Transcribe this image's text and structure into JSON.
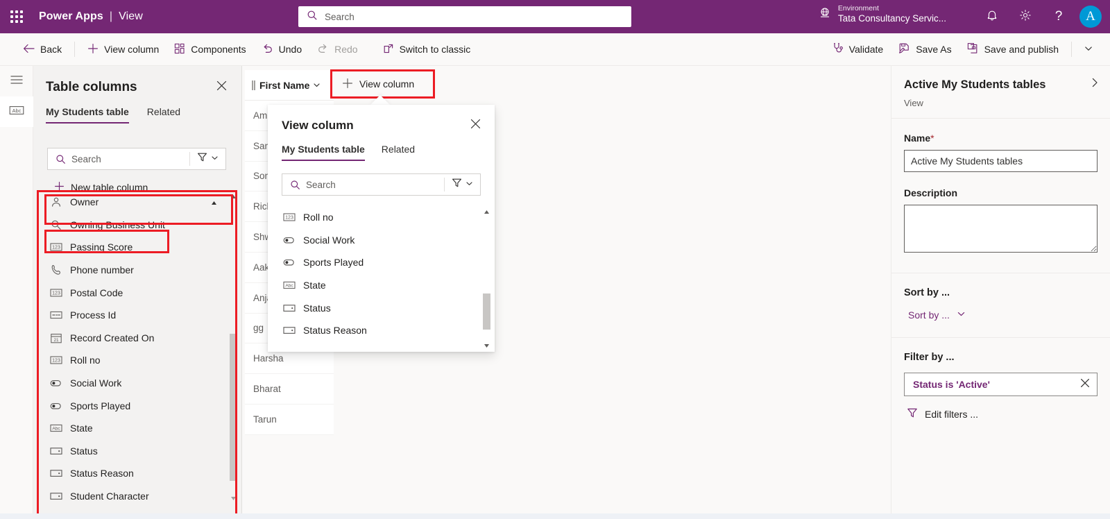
{
  "header": {
    "waffle_icon": "waffle-grid-icon",
    "brand": "Power Apps",
    "separator": "|",
    "brand_sub": "View",
    "search_placeholder": "Search",
    "search_icon": "search-icon",
    "environment_label": "Environment",
    "environment_name": "Tata Consultancy Servic...",
    "environment_icon": "globe-icon",
    "notifications_icon": "bell-icon",
    "settings_icon": "gear-icon",
    "help_icon": "question-icon",
    "avatar_initial": "A",
    "avatar_color": "#0099d6",
    "brand_color": "#742774"
  },
  "commandbar": {
    "items": [
      {
        "label": "Back",
        "icon": "arrow-left-icon",
        "disabled": false
      },
      {
        "label": "View column",
        "icon": "plus-icon",
        "disabled": false
      },
      {
        "label": "Components",
        "icon": "components-icon",
        "disabled": false
      },
      {
        "label": "Undo",
        "icon": "undo-icon",
        "disabled": false
      },
      {
        "label": "Redo",
        "icon": "redo-icon",
        "disabled": true
      },
      {
        "label": "Switch to classic",
        "icon": "open-external-icon",
        "disabled": false
      }
    ],
    "right_items": [
      {
        "label": "Validate",
        "icon": "stethoscope-icon"
      },
      {
        "label": "Save As",
        "icon": "save-as-icon"
      },
      {
        "label": "Save and publish",
        "icon": "save-publish-icon"
      }
    ],
    "overflow_icon": "chevron-down-icon"
  },
  "rail": {
    "items": [
      {
        "icon": "hamburger-icon",
        "active": false
      },
      {
        "icon": "abc-text-icon",
        "active": true
      }
    ]
  },
  "left_panel": {
    "title": "Table columns",
    "close_icon": "close-icon",
    "tabs": [
      {
        "label": "My Students table",
        "active": true
      },
      {
        "label": "Related",
        "active": false
      }
    ],
    "search_placeholder": "Search",
    "search_icon": "search-icon",
    "filter_icon": "funnel-icon",
    "filter_chevron_icon": "chevron-down-icon",
    "new_column_label": "New table column",
    "new_column_icon": "plus-icon",
    "scroll_up_icon": "caret-up-icon",
    "scroll_down_icon": "caret-down-icon",
    "columns": [
      {
        "label": "Owner",
        "icon": "person-icon",
        "trailing_icon": "caret-up-icon"
      },
      {
        "label": "Owning Business Unit",
        "icon": "lookup-icon"
      },
      {
        "label": "Passing Score",
        "icon": "number-123-icon"
      },
      {
        "label": "Phone number",
        "icon": "phone-icon"
      },
      {
        "label": "Postal Code",
        "icon": "number-123-icon"
      },
      {
        "label": "Process Id",
        "icon": "unique-id-icon"
      },
      {
        "label": "Record Created On",
        "icon": "calendar-21-icon"
      },
      {
        "label": "Roll no",
        "icon": "number-123-icon"
      },
      {
        "label": "Social Work",
        "icon": "toggle-icon"
      },
      {
        "label": "Sports Played",
        "icon": "toggle-icon"
      },
      {
        "label": "State",
        "icon": "abc-text-icon"
      },
      {
        "label": "Status",
        "icon": "choice-icon"
      },
      {
        "label": "Status Reason",
        "icon": "choice-icon"
      },
      {
        "label": "Student Character",
        "icon": "choice-icon"
      }
    ]
  },
  "grid": {
    "column_header": "First Name",
    "header_sort_icon": "chevron-down-icon",
    "add_column_label": "View column",
    "add_column_icon": "plus-icon",
    "rows": [
      "Ami",
      "Sanj",
      "Soni",
      "Rich",
      "Shw",
      "Aaka",
      "Anja",
      "gg",
      "Harsha",
      "Bharat",
      "Tarun"
    ]
  },
  "callout": {
    "title": "View column",
    "close_icon": "close-icon",
    "tabs": [
      {
        "label": "My Students table",
        "active": true
      },
      {
        "label": "Related",
        "active": false
      }
    ],
    "search_placeholder": "Search",
    "search_icon": "search-icon",
    "filter_icon": "funnel-icon",
    "filter_chevron_icon": "chevron-down-icon",
    "scroll_up_icon": "caret-up-icon",
    "scroll_down_icon": "caret-down-icon",
    "columns": [
      {
        "label": "Roll no",
        "icon": "number-123-icon"
      },
      {
        "label": "Social Work",
        "icon": "toggle-icon"
      },
      {
        "label": "Sports Played",
        "icon": "toggle-icon"
      },
      {
        "label": "State",
        "icon": "abc-text-icon"
      },
      {
        "label": "Status",
        "icon": "choice-icon"
      },
      {
        "label": "Status Reason",
        "icon": "choice-icon"
      }
    ]
  },
  "right_panel": {
    "title": "Active My Students tables",
    "subtitle": "View",
    "expand_icon": "chevron-right-icon",
    "name_label": "Name",
    "name_required": "*",
    "name_value": "Active My Students tables",
    "description_label": "Description",
    "description_value": "",
    "sort_section_title": "Sort by ...",
    "sort_value": "Sort by ...",
    "sort_chevron_icon": "chevron-down-icon",
    "filter_section_title": "Filter by ...",
    "filter_pill_text": "Status is 'Active'",
    "filter_pill_remove_icon": "close-icon",
    "edit_filters_label": "Edit filters ...",
    "edit_filters_icon": "funnel-icon"
  },
  "highlights": {
    "color": "#ec1c24",
    "regions": [
      "left-search-box",
      "new-table-column-button",
      "table-columns-list",
      "view-column-toolbar-button"
    ]
  }
}
